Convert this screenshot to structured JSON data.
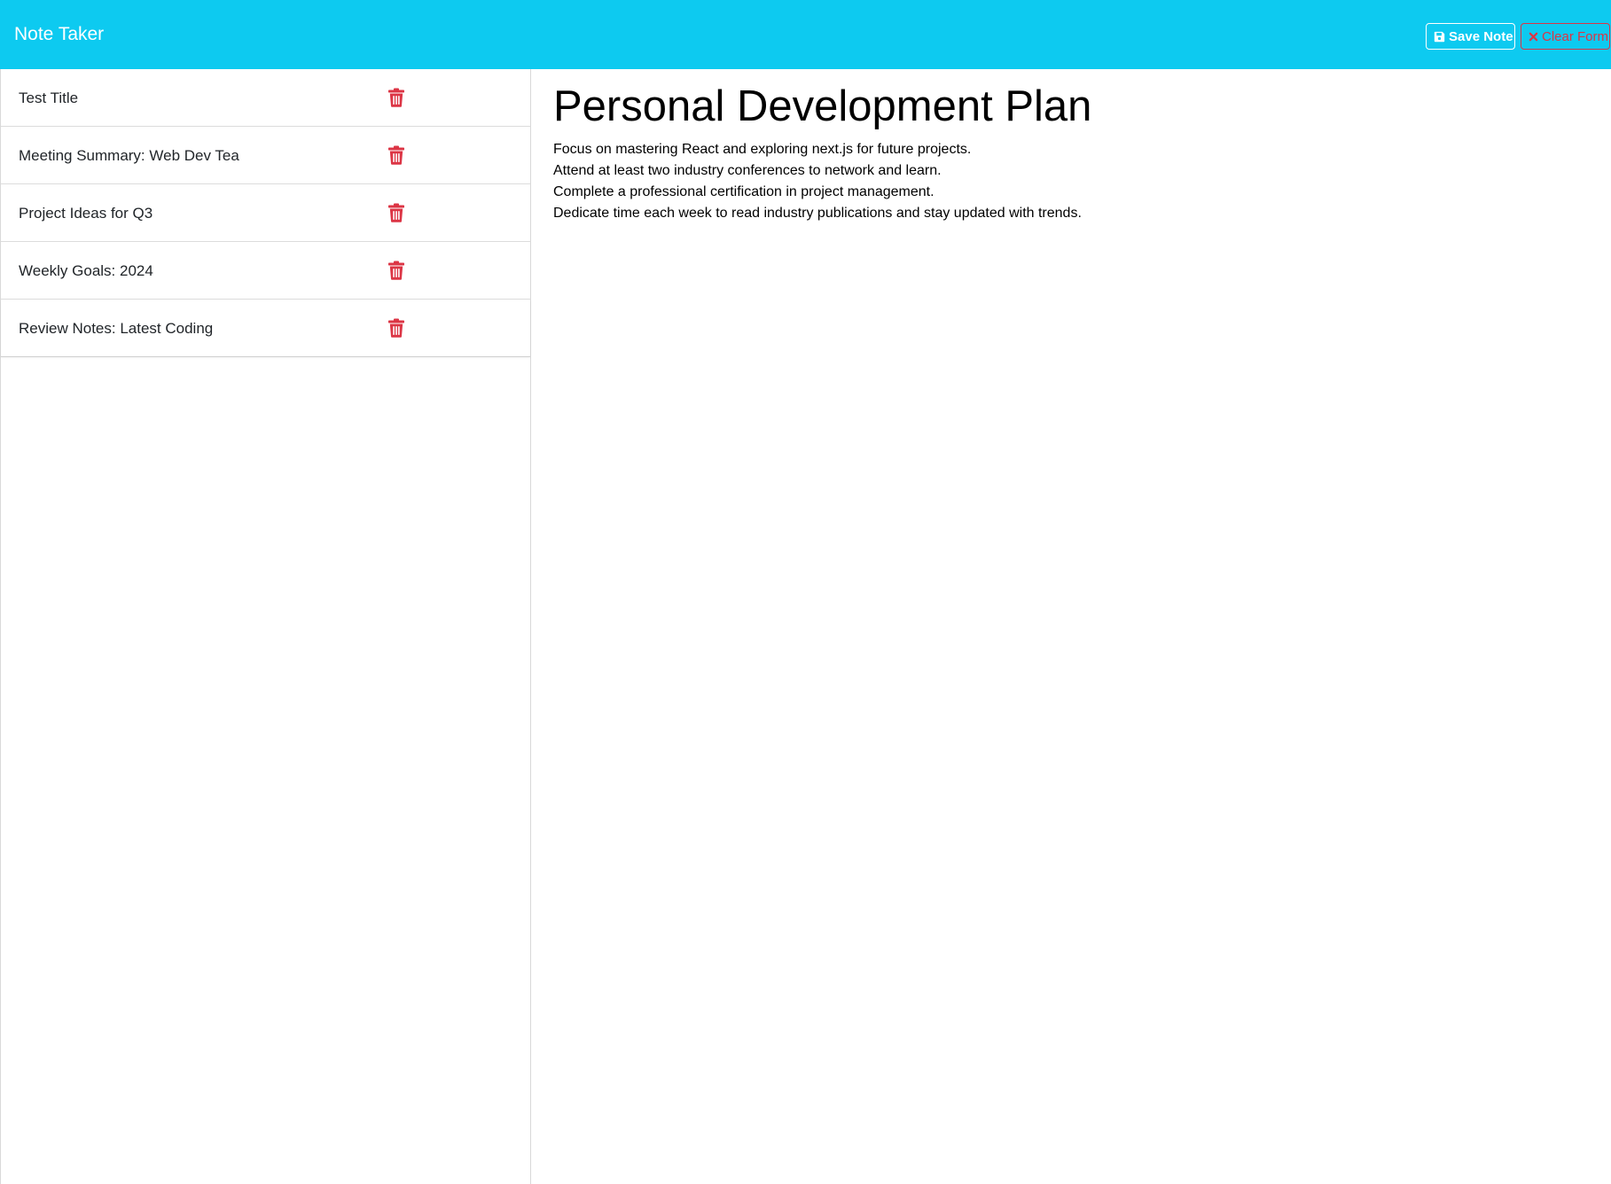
{
  "header": {
    "brand": "Note Taker",
    "save_label": "Save Note",
    "clear_label": "Clear Form",
    "save_icon": "floppy-disk-icon",
    "clear_icon": "x-mark-icon"
  },
  "sidebar": {
    "notes": [
      {
        "title": "Test Title",
        "icon": "trash-icon"
      },
      {
        "title": "Meeting Summary: Web Dev Tea",
        "icon": "trash-icon"
      },
      {
        "title": "Project Ideas for Q3",
        "icon": "trash-icon"
      },
      {
        "title": "Weekly Goals: 2024",
        "icon": "trash-icon"
      },
      {
        "title": "Review Notes: Latest Coding",
        "icon": "trash-icon"
      }
    ]
  },
  "main": {
    "title": "Personal Development Plan",
    "lines": [
      "Focus on mastering React and exploring next.js for future projects.",
      "Attend at least two industry conferences to network and learn.",
      "Complete a professional certification in project management.",
      "Dedicate time each week to read industry publications and stay updated with trends."
    ]
  },
  "colors": {
    "navbar": "#0dcaf0",
    "danger": "#dc3545",
    "nav_text": "#ffffff"
  }
}
